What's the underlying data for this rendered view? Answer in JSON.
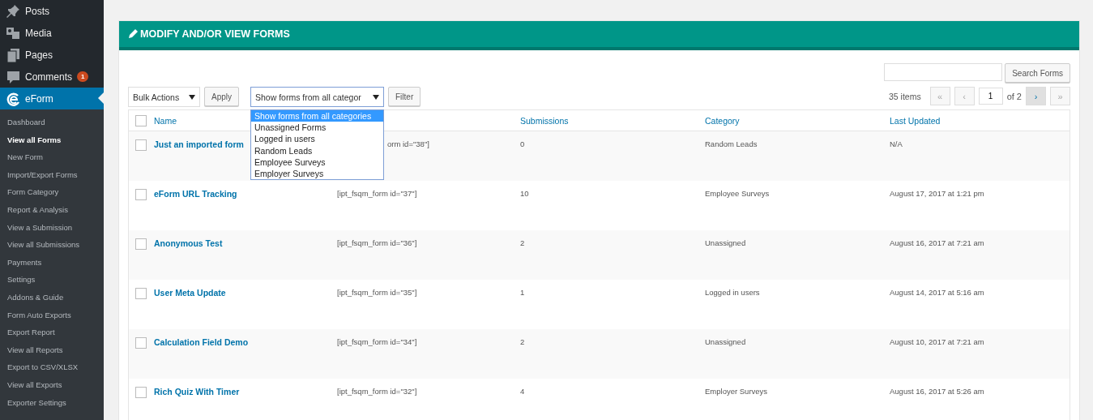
{
  "sidebar": {
    "items": [
      {
        "label": "Posts",
        "selected": false
      },
      {
        "label": "Media",
        "selected": false
      },
      {
        "label": "Pages",
        "selected": false
      },
      {
        "label": "Comments",
        "badge": "1",
        "selected": false
      },
      {
        "label": "eForm",
        "selected": true
      }
    ],
    "submenu": [
      {
        "label": "Dashboard",
        "selected": false
      },
      {
        "label": "View all Forms",
        "selected": true
      },
      {
        "label": "New Form",
        "selected": false
      },
      {
        "label": "Import/Export Forms",
        "selected": false
      },
      {
        "label": "Form Category",
        "selected": false
      },
      {
        "label": "Report & Analysis",
        "selected": false
      },
      {
        "label": "View a Submission",
        "selected": false
      },
      {
        "label": "View all Submissions",
        "selected": false
      },
      {
        "label": "Payments",
        "selected": false
      },
      {
        "label": "Settings",
        "selected": false
      },
      {
        "label": "Addons & Guide",
        "selected": false
      },
      {
        "label": "Form Auto Exports",
        "selected": false
      },
      {
        "label": "Export Report",
        "selected": false
      },
      {
        "label": "View all Reports",
        "selected": false
      },
      {
        "label": "Export to CSV/XLSX",
        "selected": false
      },
      {
        "label": "View all Exports",
        "selected": false
      },
      {
        "label": "Exporter Settings",
        "selected": false
      }
    ]
  },
  "panel": {
    "title": "MODIFY AND/OR VIEW FORMS",
    "search": {
      "button": "Search Forms"
    },
    "bulk_actions": {
      "value": "Bulk Actions",
      "button": "Apply"
    },
    "category_filter": {
      "value": "Show forms from all categor",
      "open": true,
      "button": "Filter",
      "options": [
        {
          "label": "Show forms from all categories",
          "selected": true
        },
        {
          "label": "Unassigned Forms",
          "selected": false
        },
        {
          "label": "Logged in users",
          "selected": false
        },
        {
          "label": "Random Leads",
          "selected": false
        },
        {
          "label": "Employee Surveys",
          "selected": false
        },
        {
          "label": "Employer Surveys",
          "selected": false
        }
      ]
    },
    "pagination": {
      "count": "35 items",
      "first": "«",
      "prev": "‹",
      "page": "1",
      "of": "of 2",
      "next": "›",
      "last": "»"
    },
    "table": {
      "columns": [
        "Name",
        "Submissions",
        "Category",
        "Last Updated"
      ],
      "all_checked": false,
      "rows": [
        {
          "name": "Just an imported form",
          "shortcode": "orm id=\"38\"]",
          "checked": false,
          "submissions": "0",
          "category": "Random Leads",
          "updated": "N/A"
        },
        {
          "name": "eForm URL Tracking",
          "shortcode": "[ipt_fsqm_form id=\"37\"]",
          "checked": false,
          "submissions": "10",
          "category": "Employee Surveys",
          "updated": "August 17, 2017 at 1:21 pm"
        },
        {
          "name": "Anonymous Test",
          "shortcode": "[ipt_fsqm_form id=\"36\"]",
          "checked": false,
          "submissions": "2",
          "category": "Unassigned",
          "updated": "August 16, 2017 at 7:21 am"
        },
        {
          "name": "User Meta Update",
          "shortcode": "[ipt_fsqm_form id=\"35\"]",
          "checked": false,
          "submissions": "1",
          "category": "Logged in users",
          "updated": "August 14, 2017 at 5:16 am"
        },
        {
          "name": "Calculation Field Demo",
          "shortcode": "[ipt_fsqm_form id=\"34\"]",
          "checked": false,
          "submissions": "2",
          "category": "Unassigned",
          "updated": "August 10, 2017 at 7:21 am"
        },
        {
          "name": "Rich Quiz With Timer",
          "shortcode": "[ipt_fsqm_form id=\"32\"]",
          "checked": false,
          "submissions": "4",
          "category": "Employer Surveys",
          "updated": "August 16, 2017 at 5:26 am"
        }
      ]
    }
  }
}
